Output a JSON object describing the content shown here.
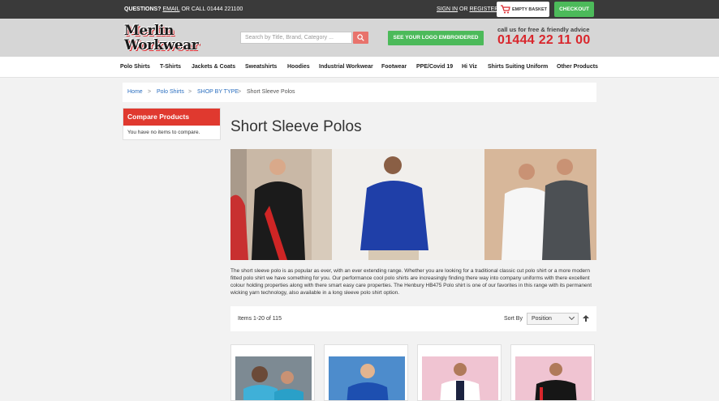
{
  "topbar": {
    "questions": "QUESTIONS?",
    "email": "EMAIL",
    "call": "OR CALL 01444 221100",
    "sign_in": "SIGN IN",
    "or": "OR",
    "register": "REGISTER",
    "basket": "EMPTY BASKET",
    "checkout": "CHECKOUT"
  },
  "header": {
    "logo_line1": "Merlin",
    "logo_line2": "Workwear",
    "search_placeholder": "Search by Title, Brand, Category ...",
    "logo_button": "SEE YOUR LOGO EMBROIDERED",
    "call_us": "call us for free & friendly advice",
    "phone": "01444 22 11 00"
  },
  "nav": {
    "items": [
      "Polo Shirts",
      "T-Shirts",
      "Jackets & Coats",
      "Sweatshirts",
      "Hoodies",
      "Industrial Workwear",
      "Footwear",
      "PPE/Covid 19",
      "Hi Viz",
      "Shirts Suiting Uniform",
      "Other Products"
    ]
  },
  "breadcrumb": {
    "home": "Home",
    "sep": ">",
    "polo": "Polo Shirts",
    "type": "SHOP BY TYPE",
    "current": "Short Sleeve Polos"
  },
  "sidebar": {
    "compare_title": "Compare Products",
    "compare_text": "You have no items to compare."
  },
  "main": {
    "title": "Short Sleeve Polos",
    "description": "The short sleeve polo is as popular as ever, with an ever extending range. Whether you are looking for a traditional classic cut polo shirt or a more modern fitted polo shirt we have something for you. Our performance cool polo shirts are increasingly finding there way into company uniforms with there excellent colour holding properties along with there smart easy care properties. The Henbury HB475 Polo shirt is one of our favorites in this range with its permanent wicking yarn technology, also available in a long sleeve polo shirt option."
  },
  "toolbar": {
    "count": "Items 1-20 of 115",
    "sort_label": "Sort By",
    "sort_value": "Position"
  },
  "colors": {
    "accent_red": "#e0392f",
    "accent_green": "#4cba5a",
    "link_blue": "#2a6ebf"
  }
}
